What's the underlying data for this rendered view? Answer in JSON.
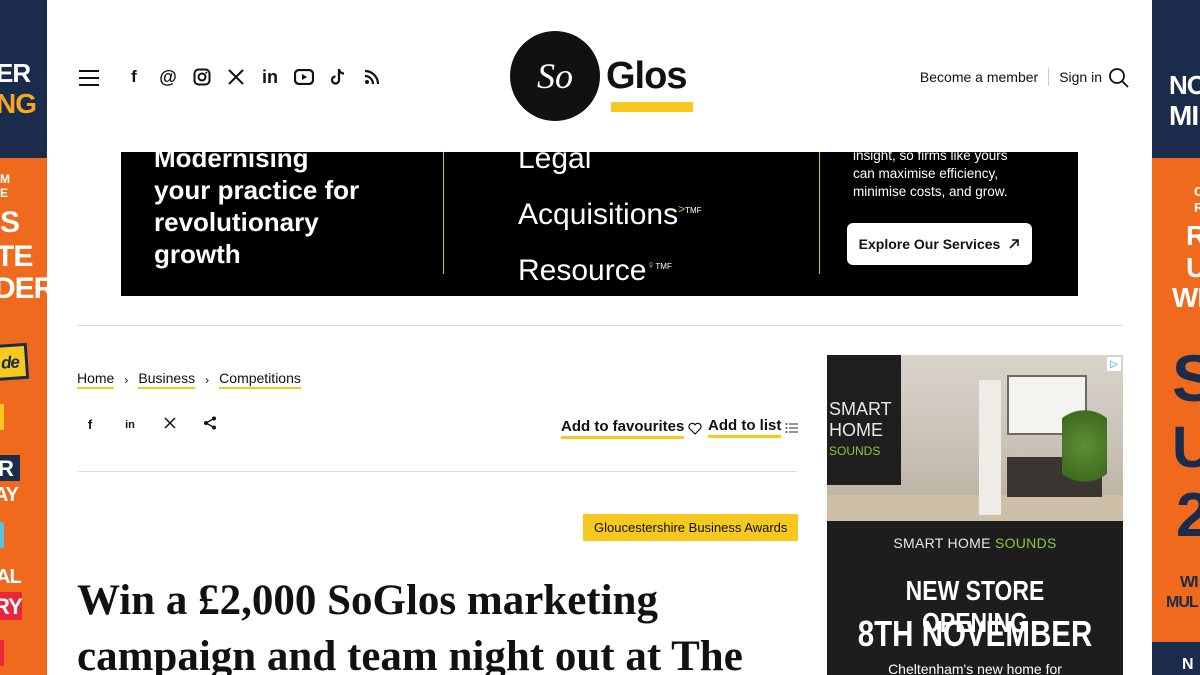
{
  "skins": {
    "left_lines": [
      "ER",
      "NG",
      "M",
      "E",
      "S",
      "TE",
      "DER",
      "de",
      "R",
      "AY",
      "AL",
      "RY"
    ],
    "right_lines": [
      "NO",
      "MI",
      "C",
      "R",
      "R",
      "U",
      "WE",
      "S",
      "U",
      "2",
      "WI",
      "MUL",
      "N"
    ]
  },
  "header": {
    "social_icons": [
      "facebook-icon",
      "threads-icon",
      "instagram-icon",
      "x-icon",
      "linkedin-icon",
      "youtube-icon",
      "tiktok-icon",
      "rss-icon"
    ],
    "logo_so": "So",
    "logo_glos": "Glos",
    "become_member": "Become a member",
    "sign_in": "Sign in"
  },
  "ad_top": {
    "col1": [
      "Modernising",
      "your practice for",
      "revolutionary",
      "growth"
    ],
    "col2_line1": "Legal",
    "col2_line2": "Acquisitions",
    "col2_line3": "Resource",
    "tmf": "TMF",
    "col3": [
      "insight, so firms like yours",
      "can maximise efficiency,",
      "minimise costs, and grow."
    ],
    "button": "Explore Our Services"
  },
  "breadcrumb": [
    "Home",
    "Business",
    "Competitions"
  ],
  "share_icons": [
    "f",
    "in",
    "𝕏",
    "share"
  ],
  "actions": {
    "favourites": "Add to favourites",
    "list": "Add to list"
  },
  "tag": "Gloucestershire Business Awards",
  "headline": {
    "line1": "Win a £2,000 SoGlos marketing",
    "line2": "campaign and team night out at The"
  },
  "ad_side": {
    "wall_text": [
      "SMART",
      "HOME"
    ],
    "wall_sounds": "SOUNDS",
    "brand_prefix": "SMART HOME ",
    "brand_green": "SOUNDS",
    "line1": "NEW STORE OPENING",
    "line2": "8TH NOVEMBER",
    "line3": "Cheltenham's new home for"
  },
  "colors": {
    "accent_yellow": "#f7c81e",
    "skin_orange": "#f06a1d",
    "skin_navy": "#1a2b4c",
    "ad_green": "#b6d33a"
  }
}
